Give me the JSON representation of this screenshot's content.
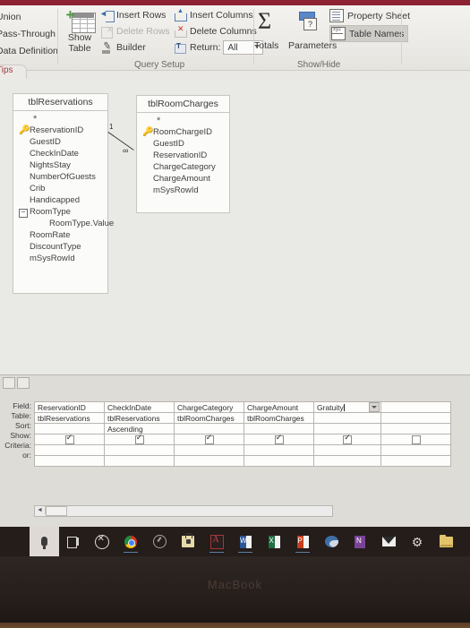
{
  "app": {
    "name": "Microsoft Access Query Design",
    "accent_maroon": "#8c2332",
    "canvas_bg": "#e9e9e6"
  },
  "ribbon": {
    "left_column": [
      {
        "label": "Union"
      },
      {
        "label": "Pass-Through"
      },
      {
        "label": "Data Definition"
      }
    ],
    "show_table": {
      "line1": "Show",
      "line2": "Table",
      "icon": "table-plus-icon"
    },
    "query_setup": {
      "group_label": "Query Setup",
      "items": [
        {
          "label": "Insert Rows",
          "icon": "insert-rows-icon",
          "enabled": true
        },
        {
          "label": "Delete Rows",
          "icon": "delete-rows-icon",
          "enabled": false
        },
        {
          "label": "Builder",
          "icon": "builder-icon",
          "enabled": true
        },
        {
          "label": "Insert Columns",
          "icon": "insert-columns-icon",
          "enabled": true
        },
        {
          "label": "Delete Columns",
          "icon": "delete-columns-icon",
          "enabled": true
        }
      ],
      "return": {
        "label": "Return:",
        "value": "All",
        "icon": "return-rows-icon"
      }
    },
    "show_hide": {
      "group_label": "Show/Hide",
      "totals": {
        "label": "Totals",
        "icon": "sigma-icon"
      },
      "parameters": {
        "label": "Parameters",
        "icon": "parameters-icon"
      },
      "property_sheet": {
        "label": "Property Sheet",
        "icon": "property-sheet-icon",
        "active": false
      },
      "table_names": {
        "label": "Table Names",
        "icon": "table-names-icon",
        "active": true
      }
    }
  },
  "tips_tab": {
    "label": "Tips"
  },
  "diagram": {
    "tables": [
      {
        "name": "tblReservations",
        "star": "*",
        "fields": [
          {
            "name": "ReservationID",
            "key": true,
            "expandable": false,
            "child": false
          },
          {
            "name": "GuestID",
            "key": false,
            "expandable": false,
            "child": false
          },
          {
            "name": "CheckInDate",
            "key": false,
            "expandable": false,
            "child": false
          },
          {
            "name": "NightsStay",
            "key": false,
            "expandable": false,
            "child": false
          },
          {
            "name": "NumberOfGuests",
            "key": false,
            "expandable": false,
            "child": false
          },
          {
            "name": "Crib",
            "key": false,
            "expandable": false,
            "child": false
          },
          {
            "name": "Handicapped",
            "key": false,
            "expandable": false,
            "child": false
          },
          {
            "name": "RoomType",
            "key": false,
            "expandable": true,
            "child": false
          },
          {
            "name": "RoomType.Value",
            "key": false,
            "expandable": false,
            "child": true
          },
          {
            "name": "RoomRate",
            "key": false,
            "expandable": false,
            "child": false
          },
          {
            "name": "DiscountType",
            "key": false,
            "expandable": false,
            "child": false
          },
          {
            "name": "mSysRowId",
            "key": false,
            "expandable": false,
            "child": false
          }
        ]
      },
      {
        "name": "tblRoomCharges",
        "star": "*",
        "fields": [
          {
            "name": "RoomChargeID",
            "key": true,
            "expandable": false,
            "child": false
          },
          {
            "name": "GuestID",
            "key": false,
            "expandable": false,
            "child": false
          },
          {
            "name": "ReservationID",
            "key": false,
            "expandable": false,
            "child": false
          },
          {
            "name": "ChargeCategory",
            "key": false,
            "expandable": false,
            "child": false
          },
          {
            "name": "ChargeAmount",
            "key": false,
            "expandable": false,
            "child": false
          },
          {
            "name": "mSysRowId",
            "key": false,
            "expandable": false,
            "child": false
          }
        ]
      }
    ],
    "join": {
      "left_cardinality": "1",
      "right_cardinality": "∞",
      "from_table": "tblReservations",
      "from_field": "ReservationID",
      "to_table": "tblRoomCharges",
      "to_field": "ReservationID"
    }
  },
  "grid": {
    "row_labels": [
      "Field:",
      "Table:",
      "Sort:",
      "Show:",
      "Criteria:",
      "or:"
    ],
    "columns": [
      {
        "field": "ReservationID",
        "table": "tblReservations",
        "sort": "",
        "show": true,
        "criteria": "",
        "or": "",
        "active": false
      },
      {
        "field": "CheckInDate",
        "table": "tblReservations",
        "sort": "Ascending",
        "show": true,
        "criteria": "",
        "or": "",
        "active": false
      },
      {
        "field": "ChargeCategory",
        "table": "tblRoomCharges",
        "sort": "",
        "show": true,
        "criteria": "",
        "or": "",
        "active": false
      },
      {
        "field": "ChargeAmount",
        "table": "tblRoomCharges",
        "sort": "",
        "show": true,
        "criteria": "",
        "or": "",
        "active": false
      },
      {
        "field": "Gratuity",
        "table": "",
        "sort": "",
        "show": true,
        "criteria": "",
        "or": "",
        "active": true
      },
      {
        "field": "",
        "table": "",
        "sort": "",
        "show": false,
        "criteria": "",
        "or": "",
        "active": false
      }
    ],
    "scrollbar": {
      "left_arrow": "◄"
    }
  },
  "taskbar": {
    "search_icon": "microphone-icon",
    "icons": [
      {
        "name": "task-view-icon",
        "running": false
      },
      {
        "name": "xbox-icon",
        "running": false
      },
      {
        "name": "chrome-icon",
        "running": true
      },
      {
        "name": "cortana-icon",
        "running": false
      },
      {
        "name": "store-icon",
        "running": false
      },
      {
        "name": "access-icon",
        "running": true
      },
      {
        "name": "word-icon",
        "running": true
      },
      {
        "name": "excel-icon",
        "running": false
      },
      {
        "name": "powerpoint-icon",
        "running": true
      },
      {
        "name": "edge-icon",
        "running": false
      },
      {
        "name": "onenote-icon",
        "running": false
      },
      {
        "name": "mail-icon",
        "running": false
      },
      {
        "name": "settings-gear-icon",
        "running": false
      },
      {
        "name": "file-explorer-icon",
        "running": false
      }
    ]
  },
  "device": {
    "brand": "MacBook"
  }
}
